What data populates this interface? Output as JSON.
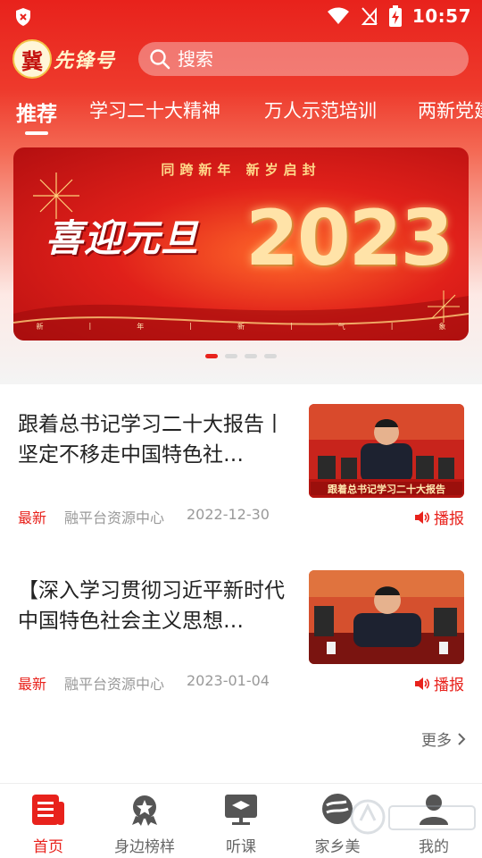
{
  "status_bar": {
    "time": "10:57"
  },
  "app": {
    "logo_text": "冀先锋号",
    "logo_seal": "冀",
    "logo_name": "先锋号"
  },
  "search": {
    "placeholder": "搜索"
  },
  "tabs": [
    {
      "label": "推荐",
      "active": true
    },
    {
      "label": "学习二十大精神"
    },
    {
      "label": "万人示范培训"
    },
    {
      "label": "两新党建"
    }
  ],
  "banner": {
    "topline": "同跨新年    新岁启封",
    "greeting": "喜迎元旦",
    "year": "2023",
    "strip": [
      "新",
      "|",
      "年",
      "|",
      "新",
      "|",
      "气",
      "|",
      "象"
    ],
    "dots_total": 4,
    "dots_active": 1
  },
  "news": [
    {
      "title": "跟着总书记学习二十大报告丨坚定不移走中国特色社…",
      "tag": "最新",
      "source": "融平台资源中心",
      "date": "2022-12-30",
      "play_label": "播报",
      "thumb_caption": "跟着总书记学习二十大报告"
    },
    {
      "title": "【深入学习贯彻习近平新时代中国特色社会主义思想…",
      "tag": "最新",
      "source": "融平台资源中心",
      "date": "2023-01-04",
      "play_label": "播报"
    }
  ],
  "more_label": "更多",
  "bottom_nav": [
    {
      "label": "首页",
      "icon": "home-doc-icon",
      "active": true
    },
    {
      "label": "身边榜样",
      "icon": "badge-star-icon"
    },
    {
      "label": "听课",
      "icon": "lecture-screen-icon"
    },
    {
      "label": "家乡美",
      "icon": "hometown-icon"
    },
    {
      "label": "我的",
      "icon": "user-profile-icon"
    }
  ],
  "colors": {
    "brand_red": "#e8221c",
    "muted_text": "#999999"
  }
}
